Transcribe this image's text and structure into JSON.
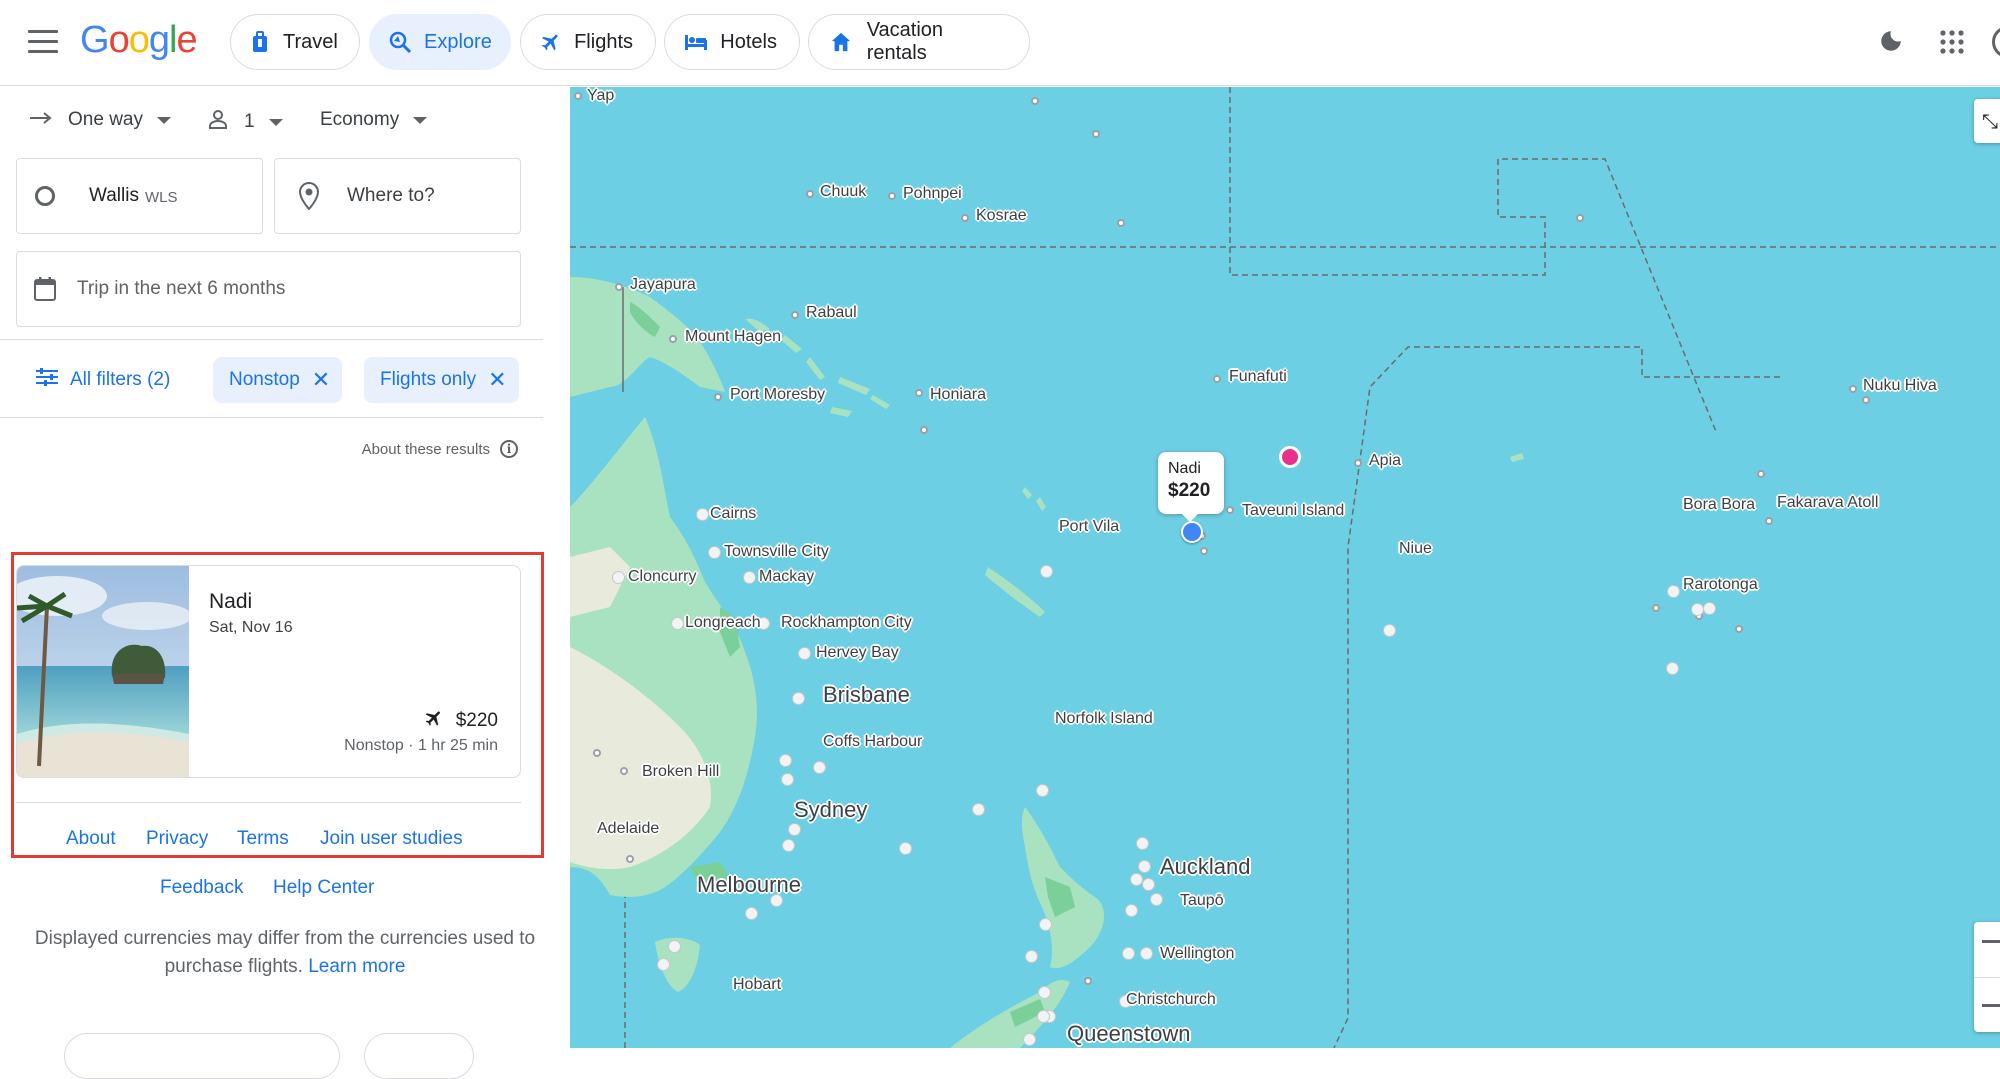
{
  "header": {
    "logo": "Google",
    "nav": [
      "Travel",
      "Explore",
      "Flights",
      "Hotels",
      "Vacation rentals"
    ]
  },
  "search": {
    "trip_type": "One way",
    "passengers": "1",
    "cabin": "Economy",
    "origin_city": "Wallis",
    "origin_code": "WLS",
    "destination_placeholder": "Where to?",
    "dates": "Trip in the next 6 months"
  },
  "filters": {
    "all_filters": "All filters (2)",
    "chips": [
      "Nonstop",
      "Flights only"
    ]
  },
  "results": {
    "about_label": "About these results",
    "items": [
      {
        "destination": "Nadi",
        "date": "Sat, Nov 16",
        "price": "$220",
        "info": "Nonstop · 1 hr 25 min"
      }
    ]
  },
  "footer": {
    "links_row1": [
      "About",
      "Privacy",
      "Terms",
      "Join user studies"
    ],
    "links_row2": [
      "Feedback",
      "Help Center"
    ],
    "disclaimer": "Displayed currencies may differ from the currencies used to purchase flights.",
    "learn_more": "Learn more"
  },
  "map": {
    "tooltip": {
      "name": "Nadi",
      "price": "$220"
    },
    "labels": [
      "Yap",
      "Chuuk",
      "Pohnpei",
      "Kosrae",
      "Jayapura",
      "Rabaul",
      "Mount Hagen",
      "Port Moresby",
      "Honiara",
      "Funafuti",
      "Nuku Hiva",
      "Apia",
      "Cairns",
      "Townsville City",
      "Cloncurry",
      "Mackay",
      "Longreach",
      "Rockhampton City",
      "Hervey Bay",
      "Brisbane",
      "Port Vila",
      "Taveuni Island",
      "Niue",
      "Bora Bora",
      "Fakarava Atoll",
      "Rarotonga",
      "Norfolk Island",
      "Coffs Harbour",
      "Broken Hill",
      "Sydney",
      "Adelaide",
      "Melbourne",
      "Auckland",
      "Taupō",
      "Wellington",
      "Christchurch",
      "Hobart",
      "Queenstown"
    ]
  },
  "colors": {
    "accent": "#1a73e8",
    "water": "#6dcfe4",
    "land": "#a8e2c0",
    "highlight": "#e53935",
    "pin": "#e8318f"
  }
}
